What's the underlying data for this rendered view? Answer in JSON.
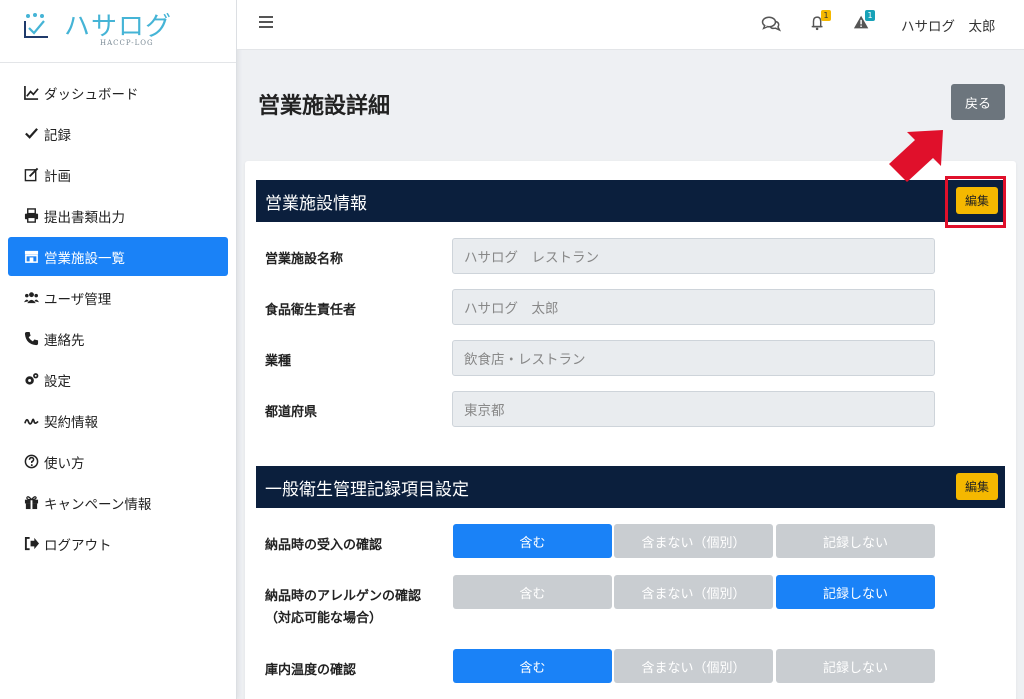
{
  "brand": {
    "name": "ハサログ",
    "sub": "HACCP-LOG",
    "color": "#45b4d6"
  },
  "sidebar": {
    "items": [
      {
        "label": "ダッシュボード",
        "icon": "chart-line-icon"
      },
      {
        "label": "記録",
        "icon": "check-icon"
      },
      {
        "label": "計画",
        "icon": "edit-icon"
      },
      {
        "label": "提出書類出力",
        "icon": "print-icon"
      },
      {
        "label": "営業施設一覧",
        "icon": "store-icon",
        "active": true
      },
      {
        "label": "ユーザ管理",
        "icon": "users-icon"
      },
      {
        "label": "連絡先",
        "icon": "phone-icon"
      },
      {
        "label": "設定",
        "icon": "gears-icon"
      },
      {
        "label": "契約情報",
        "icon": "signature-icon"
      },
      {
        "label": "使い方",
        "icon": "question-circle-icon"
      },
      {
        "label": "キャンペーン情報",
        "icon": "gift-icon"
      },
      {
        "label": "ログアウト",
        "icon": "sign-out-icon"
      }
    ]
  },
  "topbar": {
    "notifications_count": "1",
    "alerts_count": "1",
    "user_name": "ハサログ　太郎"
  },
  "page": {
    "title": "営業施設詳細",
    "back_label": "戻る"
  },
  "facility": {
    "header": "営業施設情報",
    "edit_label": "編集",
    "fields": [
      {
        "label": "営業施設名称",
        "value": "ハサログ　レストラン"
      },
      {
        "label": "食品衛生責任者",
        "value": "ハサログ　太郎"
      },
      {
        "label": "業種",
        "value": "飲食店・レストラン"
      },
      {
        "label": "都道府県",
        "value": "東京都"
      }
    ]
  },
  "hygiene": {
    "header": "一般衛生管理記録項目設定",
    "edit_label": "編集",
    "options": [
      "含む",
      "含まない（個別）",
      "記録しない"
    ],
    "rows": [
      {
        "label": "納品時の受入の確認",
        "label2": "",
        "selected": 0
      },
      {
        "label": "納品時のアレルゲンの確認",
        "label2": "（対応可能な場合）",
        "selected": 2
      },
      {
        "label": "庫内温度の確認",
        "label2": "",
        "selected": 0
      }
    ]
  },
  "colors": {
    "primary": "#1a82f7",
    "header_bg": "#0b1f3d",
    "warning": "#f5b800",
    "highlight": "#e0102b"
  }
}
